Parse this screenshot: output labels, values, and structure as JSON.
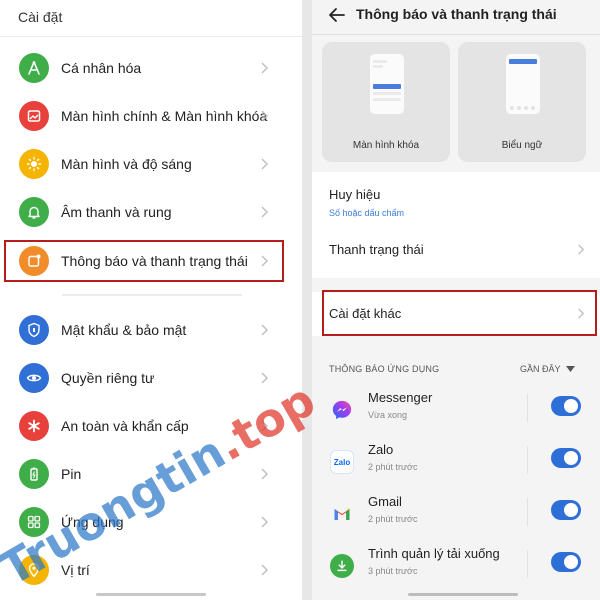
{
  "left": {
    "header": "Cài đặt",
    "items": [
      {
        "label": "Cá nhân hóa",
        "icon": "personalize-icon",
        "color": "#3fae49"
      },
      {
        "label": "Màn hình chính & Màn hình khóa",
        "icon": "home-screen-icon",
        "color": "#e8413c"
      },
      {
        "label": "Màn hình và độ sáng",
        "icon": "brightness-icon",
        "color": "#f4b400"
      },
      {
        "label": "Âm thanh và rung",
        "icon": "bell-icon",
        "color": "#3fae49"
      },
      {
        "label": "Thông báo và thanh trạng thái",
        "icon": "notification-icon",
        "color": "#f08c2a"
      },
      {
        "label": "Mật khẩu & bảo mật",
        "icon": "shield-icon",
        "color": "#2f6fd6"
      },
      {
        "label": "Quyền riêng tư",
        "icon": "eye-icon",
        "color": "#2f6fd6"
      },
      {
        "label": "An toàn và khẩn cấp",
        "icon": "emergency-icon",
        "color": "#e8413c"
      },
      {
        "label": "Pin",
        "icon": "battery-icon",
        "color": "#3fae49"
      },
      {
        "label": "Ứng dụng",
        "icon": "apps-icon",
        "color": "#3fae49"
      },
      {
        "label": "Vị trí",
        "icon": "location-icon",
        "color": "#f4b400"
      }
    ]
  },
  "right": {
    "title": "Thông báo và thanh trạng thái",
    "previews": [
      {
        "label": "Màn hình khóa"
      },
      {
        "label": "Biểu ngữ"
      }
    ],
    "badge": {
      "label": "Huy hiệu",
      "value": "Số hoặc dấu chấm"
    },
    "status_bar": {
      "label": "Thanh trạng thái"
    },
    "other_settings": {
      "label": "Cài đặt khác"
    },
    "app_section": {
      "heading": "THÔNG BÁO ỨNG DỤNG",
      "sort": "GẦN ĐÂY"
    },
    "apps": [
      {
        "name": "Messenger",
        "time": "Vừa xong",
        "enabled": true,
        "icon": "messenger-icon"
      },
      {
        "name": "Zalo",
        "time": "2 phút trước",
        "enabled": true,
        "icon": "zalo-icon"
      },
      {
        "name": "Gmail",
        "time": "2 phút trước",
        "enabled": true,
        "icon": "gmail-icon"
      },
      {
        "name": "Trình quản lý tải xuống",
        "time": "3 phút trước",
        "enabled": true,
        "icon": "download-icon"
      }
    ]
  },
  "colors": {
    "accent": "#2e6fd7",
    "highlight": "#b71c1c"
  },
  "watermark": {
    "part1": "Truongtin",
    "part2": ".top"
  }
}
